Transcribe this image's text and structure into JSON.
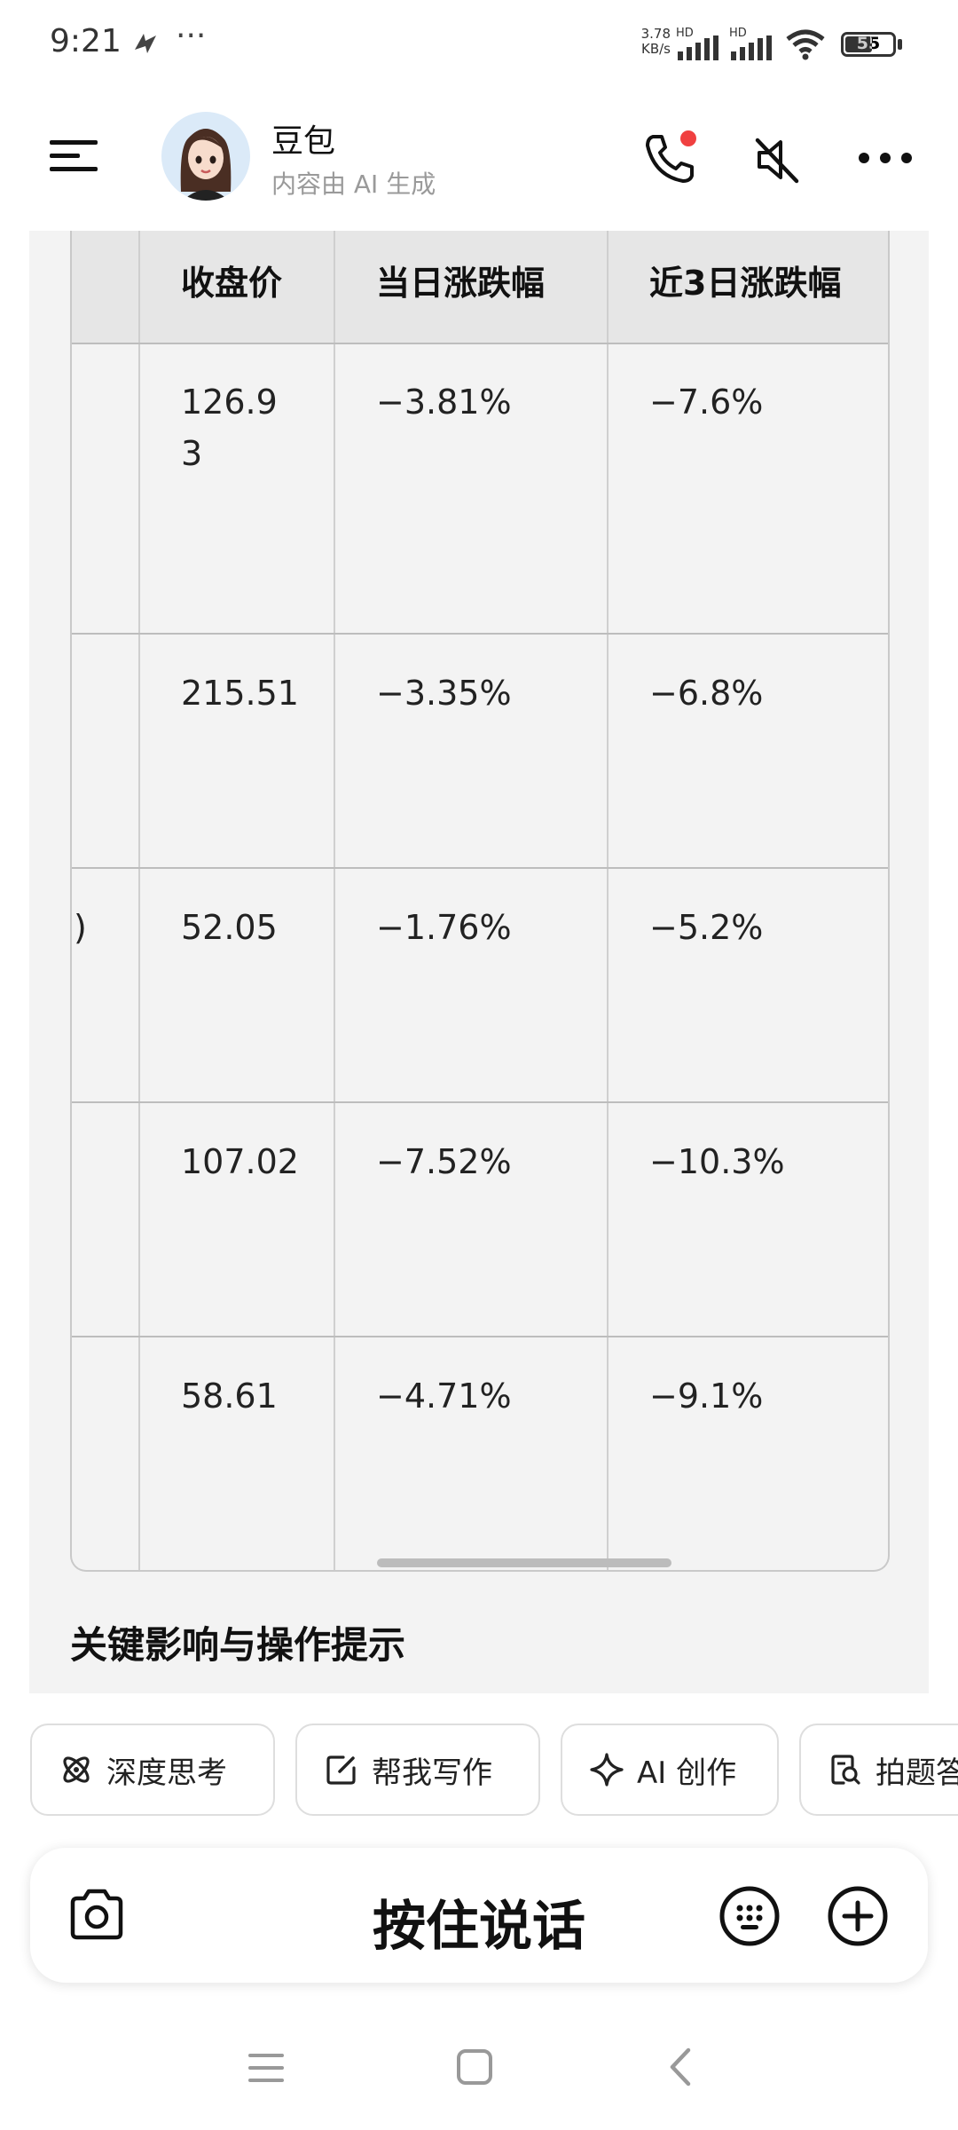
{
  "status_bar": {
    "time": "9:21",
    "net_speed_value": "3.78",
    "net_speed_unit": "KB/s",
    "sim1_label": "HD",
    "sim2_label": "HD",
    "battery": "55"
  },
  "header": {
    "name": "豆包",
    "subtitle": "内容由 AI 生成"
  },
  "table": {
    "columns": [
      "收盘价",
      "当日涨跌幅",
      "近3日涨跌幅"
    ],
    "rows": [
      {
        "partial": "",
        "close": "126.9\n3",
        "day": "−3.81%",
        "three_day": "−7.6%"
      },
      {
        "partial": "",
        "close": "215.51",
        "day": "−3.35%",
        "three_day": "−6.8%"
      },
      {
        "partial": ")",
        "close": "52.05",
        "day": "−1.76%",
        "three_day": "−5.2%"
      },
      {
        "partial": "",
        "close": "107.02",
        "day": "−7.52%",
        "three_day": "−10.3%"
      },
      {
        "partial": "",
        "close": "58.61",
        "day": "−4.71%",
        "three_day": "−9.1%"
      }
    ]
  },
  "section_title": "关键影响与操作提示",
  "chips": [
    {
      "label": "深度思考",
      "icon": "atom-icon"
    },
    {
      "label": "帮我写作",
      "icon": "edit-icon"
    },
    {
      "label": "AI 创作",
      "icon": "sparkle-icon"
    },
    {
      "label": "拍题答",
      "icon": "photo-search-icon"
    }
  ],
  "input_bar": {
    "hold_to_talk": "按住说话"
  }
}
